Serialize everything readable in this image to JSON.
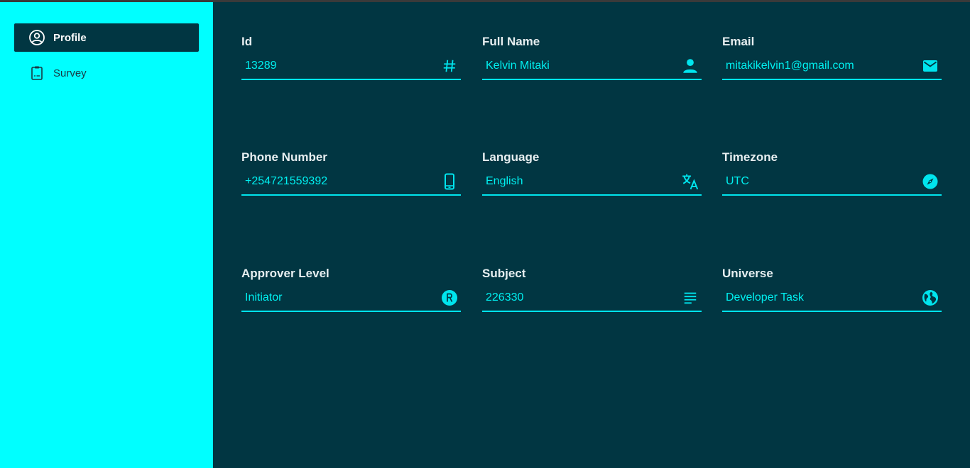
{
  "colors": {
    "sidebar_bg": "#00ffff",
    "main_bg": "#013642",
    "accent": "#00f0f0",
    "label": "#e6eef0"
  },
  "sidebar": {
    "items": [
      {
        "label": "Profile",
        "icon": "account-circle-icon",
        "active": true
      },
      {
        "label": "Survey",
        "icon": "clipboard-list-icon",
        "active": false
      }
    ]
  },
  "fields": {
    "id": {
      "label": "Id",
      "value": "13289",
      "icon": "hash-icon"
    },
    "full_name": {
      "label": "Full Name",
      "value": "Kelvin Mitaki",
      "icon": "person-icon"
    },
    "email": {
      "label": "Email",
      "value": "mitakikelvin1@gmail.com",
      "icon": "mail-icon"
    },
    "phone": {
      "label": "Phone Number",
      "value": "+254721559392",
      "icon": "smartphone-icon"
    },
    "language": {
      "label": "Language",
      "value": "English",
      "icon": "translate-icon"
    },
    "timezone": {
      "label": "Timezone",
      "value": "UTC",
      "icon": "compass-icon"
    },
    "approver_level": {
      "label": "Approver Level",
      "value": "Initiator",
      "icon": "registered-icon"
    },
    "subject": {
      "label": "Subject",
      "value": "226330",
      "icon": "notes-icon"
    },
    "universe": {
      "label": "Universe",
      "value": "Developer Task",
      "icon": "globe-icon"
    }
  }
}
